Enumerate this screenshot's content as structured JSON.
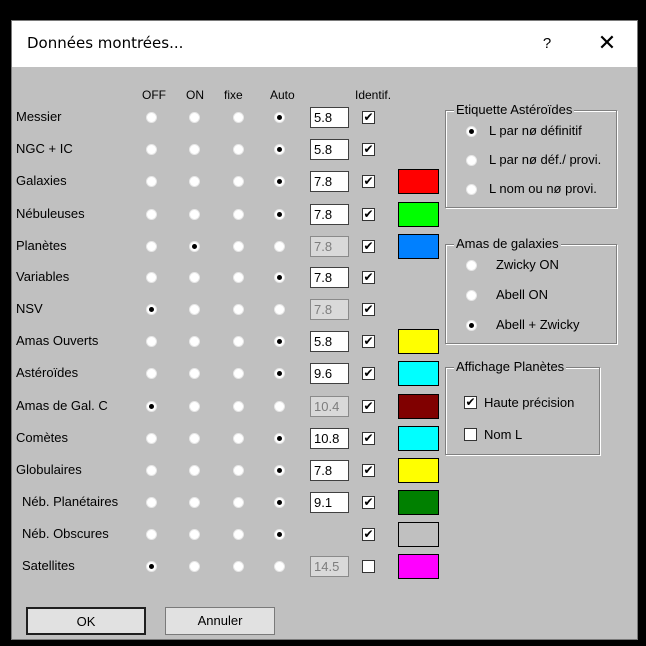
{
  "dialog": {
    "title": "Données montrées...",
    "help_label": "?",
    "close_label": "✕"
  },
  "columns": {
    "off": "OFF",
    "on": "ON",
    "fixe": "fixe",
    "auto": "Auto",
    "identif": "Identif."
  },
  "rows": [
    {
      "label": "Messier",
      "mode": "auto",
      "mag": "5.8",
      "mag_enabled": true,
      "identif": true,
      "color": null
    },
    {
      "label": "NGC + IC",
      "mode": "auto",
      "mag": "5.8",
      "mag_enabled": true,
      "identif": true,
      "color": null
    },
    {
      "label": "Galaxies",
      "mode": "auto",
      "mag": "7.8",
      "mag_enabled": true,
      "identif": true,
      "color": "#ff0000"
    },
    {
      "label": "Nébuleuses",
      "mode": "auto",
      "mag": "7.8",
      "mag_enabled": true,
      "identif": true,
      "color": "#00ff00"
    },
    {
      "label": "Planètes",
      "mode": "on",
      "mag": "7.8",
      "mag_enabled": false,
      "identif": true,
      "color": "#0080ff"
    },
    {
      "label": "Variables",
      "mode": "auto",
      "mag": "7.8",
      "mag_enabled": true,
      "identif": true,
      "color": null
    },
    {
      "label": "NSV",
      "mode": "off",
      "mag": "7.8",
      "mag_enabled": false,
      "identif": true,
      "color": null
    },
    {
      "label": "Amas Ouverts",
      "mode": "auto",
      "mag": "5.8",
      "mag_enabled": true,
      "identif": true,
      "color": "#ffff00"
    },
    {
      "label": "Astéroïdes",
      "mode": "auto",
      "mag": "9.6",
      "mag_enabled": true,
      "identif": true,
      "color": "#00ffff"
    },
    {
      "label": "Amas de Gal. C",
      "mode": "off",
      "mag": "10.4",
      "mag_enabled": false,
      "identif": true,
      "color": "#800000"
    },
    {
      "label": "Comètes",
      "mode": "auto",
      "mag": "10.8",
      "mag_enabled": true,
      "identif": true,
      "color": "#00ffff"
    },
    {
      "label": "Globulaires",
      "mode": "auto",
      "mag": "7.8",
      "mag_enabled": true,
      "identif": true,
      "color": "#ffff00"
    },
    {
      "label": "Néb. Planétaires",
      "mode": "auto",
      "mag": "9.1",
      "mag_enabled": true,
      "identif": true,
      "color": "#008000"
    },
    {
      "label": "Néb. Obscures",
      "mode": "auto",
      "mag": "",
      "mag_enabled": null,
      "identif": true,
      "color": "#c0c0c0"
    },
    {
      "label": "Satellites",
      "mode": "off",
      "mag": "14.5",
      "mag_enabled": false,
      "identif": false,
      "color": "#ff00ff"
    }
  ],
  "etiquette_group": {
    "title": "Etiquette Astéroïdes",
    "options": [
      {
        "label": "L par nø définitif",
        "selected": true
      },
      {
        "label": "L par nø déf./ provi.",
        "selected": false
      },
      {
        "label": "L nom ou nø provi.",
        "selected": false
      }
    ]
  },
  "amas_group": {
    "title": "Amas de galaxies",
    "options": [
      {
        "label": "Zwicky ON",
        "selected": false
      },
      {
        "label": "Abell ON",
        "selected": false
      },
      {
        "label": "Abell + Zwicky",
        "selected": true
      }
    ]
  },
  "planetes_group": {
    "title": "Affichage Planètes",
    "options": [
      {
        "label": "Haute précision",
        "checked": true
      },
      {
        "label": "Nom L",
        "checked": false
      }
    ]
  },
  "buttons": {
    "ok": "OK",
    "cancel": "Annuler"
  }
}
